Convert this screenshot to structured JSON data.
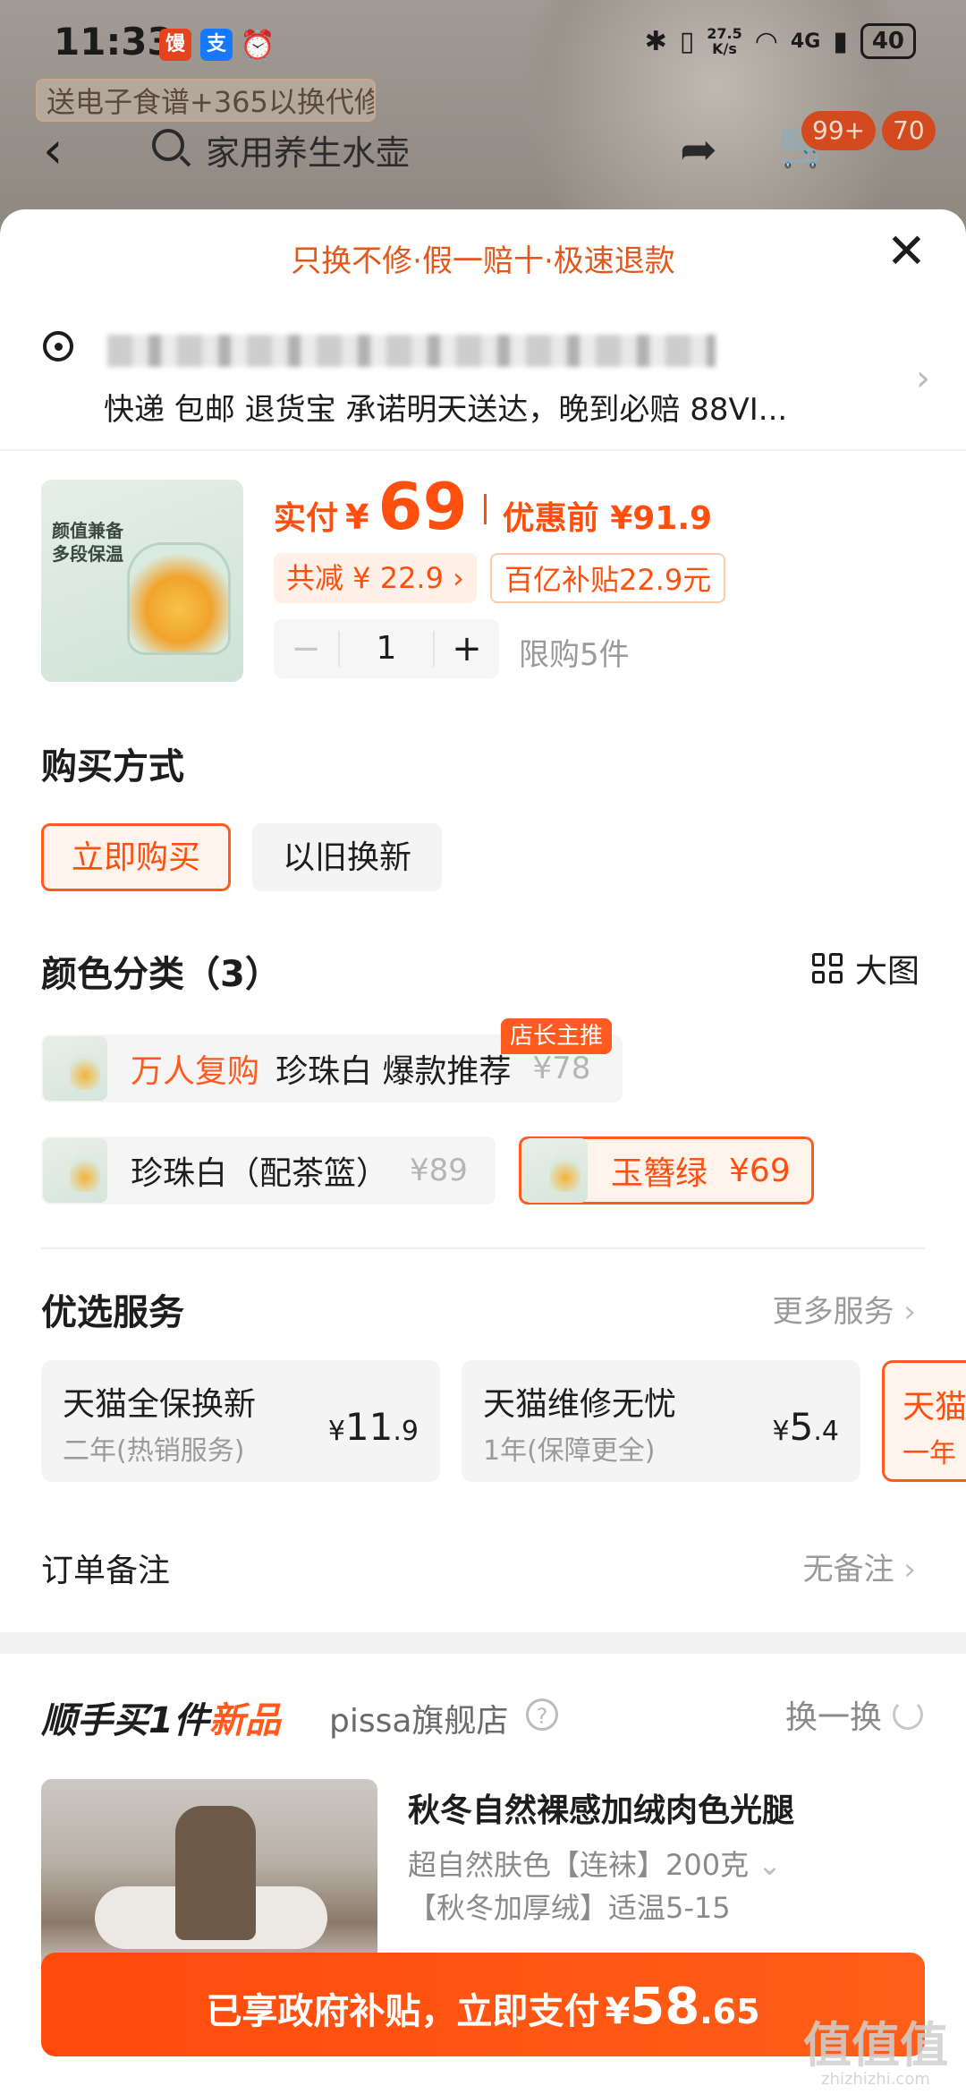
{
  "status_bar": {
    "time": "11:33",
    "net_speed_value": "27.5",
    "net_speed_unit": "K/s",
    "network": "4G",
    "battery": "40",
    "icons": [
      "app-notification-icon",
      "alipay-icon",
      "alarm-icon",
      "bluetooth-icon",
      "vibrate-icon",
      "wifi-icon",
      "signal-icon"
    ]
  },
  "background_page": {
    "banner_text": "送电子食谱+365以换代修",
    "search_text": "家用养生水壶",
    "cart_badge": "99+",
    "msg_badge": "70"
  },
  "sheet": {
    "guarantee": "只换不修·假一赔十·极速退款",
    "delivery_text": "快递 包邮 退货宝 承诺明天送达，晚到必赔 88VI...",
    "product": {
      "thumb_text": "颜值兼备\n多段保温",
      "price_label": "实付",
      "yen": "¥",
      "price": "69",
      "orig_price": "优惠前 ¥91.9",
      "reduce_chip": "共减 ¥ 22.9 ›",
      "subsidy_chip": "百亿补贴22.9元",
      "quantity": "1",
      "minus": "−",
      "plus": "+",
      "limit": "限购5件"
    },
    "purchase_method": {
      "title": "购买方式",
      "options": [
        "立即购买",
        "以旧换新"
      ],
      "selected": "立即购买"
    },
    "color": {
      "title": "颜色分类（3）",
      "big_view": "大图",
      "owner_tag": "店长主推",
      "skus": [
        {
          "tag": "万人复购",
          "name": "珍珠白 爆款推荐",
          "price": "¥78"
        },
        {
          "name": "珍珠白（配茶篮）",
          "price": "¥89"
        },
        {
          "name": "玉簪绿",
          "price": "¥69",
          "selected": true
        }
      ]
    },
    "services": {
      "title": "优选服务",
      "more": "更多服务",
      "cards": [
        {
          "title": "天猫全保换新",
          "sub": "二年(热销服务)",
          "yen": "¥",
          "int": "11",
          "dec": ".9"
        },
        {
          "title": "天猫维修无忧",
          "sub": "1年(保障更全)",
          "yen": "¥",
          "int": "5",
          "dec": ".4"
        },
        {
          "title": "天猫",
          "sub": "一年"
        }
      ]
    },
    "order_note": {
      "label": "订单备注",
      "value": "无备注"
    },
    "addon": {
      "title_main": "顺手买1件",
      "title_new": "新品",
      "store": "pissa旗舰店",
      "help": "?",
      "swap": "换一换",
      "product_name": "秋冬自然裸感加绒肉色光腿",
      "spec_line1": "超自然肤色【连袜】200克",
      "spec_line2": "【秋冬加厚绒】适温5-15"
    },
    "pay": {
      "text": "已享政府补贴，立即支付",
      "yen": "¥",
      "int": "58",
      "dec": ".65"
    },
    "watermark": {
      "main": "值值值",
      "sub": "zhizhizhi.com"
    }
  },
  "colors": {
    "accent": "#ff4f0f",
    "accent_light": "#fff3ec",
    "text": "#1d1d1d",
    "muted": "#9a9a9a"
  }
}
